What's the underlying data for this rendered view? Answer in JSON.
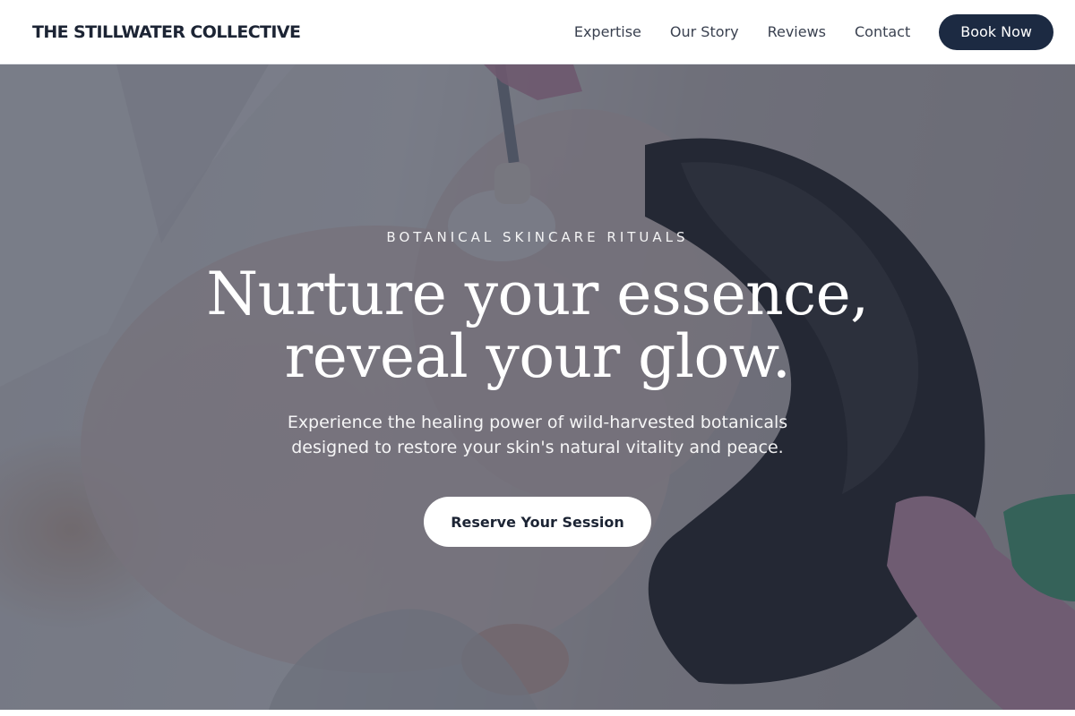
{
  "header": {
    "brand": "THE STILLWATER COLLECTIVE",
    "nav": [
      {
        "label": "Expertise"
      },
      {
        "label": "Our Story"
      },
      {
        "label": "Reviews"
      },
      {
        "label": "Contact"
      }
    ],
    "book_label": "Book Now"
  },
  "hero": {
    "eyebrow": "BOTANICAL SKINCARE RITUALS",
    "headline_line1": "Nurture your essence,",
    "headline_line2": "reveal your glow.",
    "subtext_line1": "Experience the healing power of wild-harvested botanicals",
    "subtext_line2": "designed to restore your skin's natural vitality and peace.",
    "cta_label": "Reserve Your Session"
  },
  "colors": {
    "primary_dark": "#1c2a42",
    "overlay": "#222a3e",
    "text_dark": "#1c2434",
    "white": "#ffffff"
  }
}
